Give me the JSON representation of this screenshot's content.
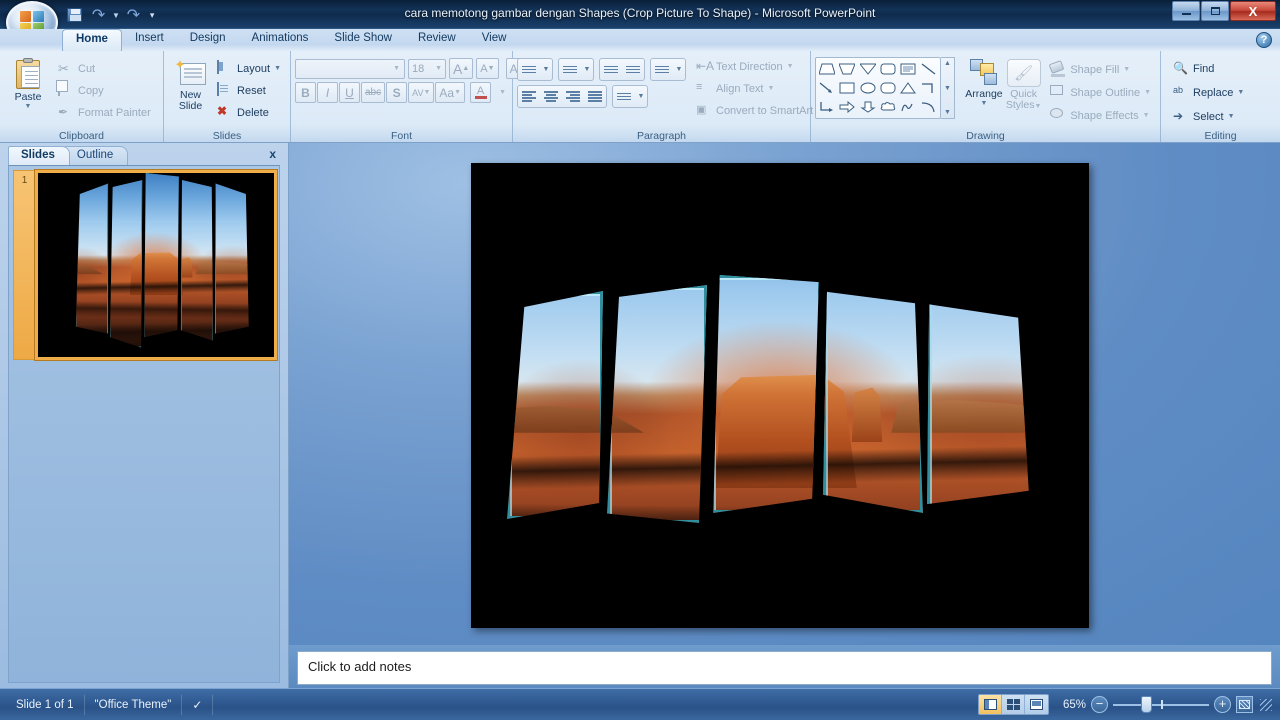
{
  "window": {
    "title": "cara memotong gambar dengan Shapes (Crop Picture To Shape)  -  Microsoft PowerPoint",
    "minimize_label": "Minimize",
    "restore_label": "Restore",
    "close_label": "X"
  },
  "quick_access": {
    "office_button": "Office Button",
    "items": [
      {
        "name": "save-icon",
        "label": "Save"
      },
      {
        "name": "undo-icon",
        "label": "Undo"
      },
      {
        "name": "redo-icon",
        "label": "Redo"
      },
      {
        "name": "customize-qat-icon",
        "label": "Customize Quick Access Toolbar"
      }
    ]
  },
  "ribbon": {
    "help_label": "?",
    "tabs": [
      {
        "label": "Home",
        "active": true
      },
      {
        "label": "Insert",
        "active": false
      },
      {
        "label": "Design",
        "active": false
      },
      {
        "label": "Animations",
        "active": false
      },
      {
        "label": "Slide Show",
        "active": false
      },
      {
        "label": "Review",
        "active": false
      },
      {
        "label": "View",
        "active": false
      }
    ],
    "groups": {
      "clipboard": {
        "label": "Clipboard",
        "paste": "Paste",
        "cut": "Cut",
        "copy": "Copy",
        "format_painter": "Format Painter"
      },
      "slides": {
        "label": "Slides",
        "new_slide_line1": "New",
        "new_slide_line2": "Slide",
        "layout": "Layout",
        "reset": "Reset",
        "delete": "Delete"
      },
      "font": {
        "label": "Font",
        "font_name": "",
        "font_name_placeholder": "",
        "font_size": "18",
        "grow_font": "A",
        "shrink_font": "A",
        "clear_formatting": "Aa",
        "bold": "B",
        "italic": "I",
        "underline": "U",
        "strikethrough": "abc",
        "shadow": "S",
        "character_spacing": "AV",
        "change_case": "Aa",
        "font_color": "A"
      },
      "paragraph": {
        "label": "Paragraph",
        "text_direction": "Text Direction",
        "align_text": "Align Text",
        "convert_to_smartart": "Convert to SmartArt"
      },
      "drawing": {
        "label": "Drawing",
        "arrange": "Arrange",
        "quick_styles_line1": "Quick",
        "quick_styles_line2": "Styles",
        "shape_fill": "Shape Fill",
        "shape_outline": "Shape Outline",
        "shape_effects": "Shape Effects"
      },
      "editing": {
        "label": "Editing",
        "find": "Find",
        "replace": "Replace",
        "select": "Select"
      }
    }
  },
  "left_pane": {
    "tabs": [
      {
        "label": "Slides",
        "active": true
      },
      {
        "label": "Outline",
        "active": false
      }
    ],
    "close_label": "x",
    "slides": [
      {
        "number": "1",
        "selected": true
      }
    ]
  },
  "slide": {
    "background_color": "#000000",
    "panel_border_color": "#2f8f9e",
    "glow_color": "#56d6e4",
    "panel_count": 5,
    "image_subject": "Monument Valley desert butte panorama"
  },
  "notes": {
    "placeholder": "Click to add notes"
  },
  "status_bar": {
    "slide_counter": "Slide 1 of 1",
    "theme": "\"Office Theme\"",
    "spellcheck_icon": "spell-check-icon",
    "views": [
      {
        "name": "normal-view",
        "label": "Normal",
        "active": true
      },
      {
        "name": "slide-sorter-view",
        "label": "Slide Sorter",
        "active": false
      },
      {
        "name": "slide-show-view",
        "label": "Slide Show",
        "active": false
      }
    ],
    "zoom_percent": "65%",
    "zoom_out_label": "−",
    "zoom_in_label": "+",
    "fit_to_window_label": "Fit slide to current window"
  }
}
